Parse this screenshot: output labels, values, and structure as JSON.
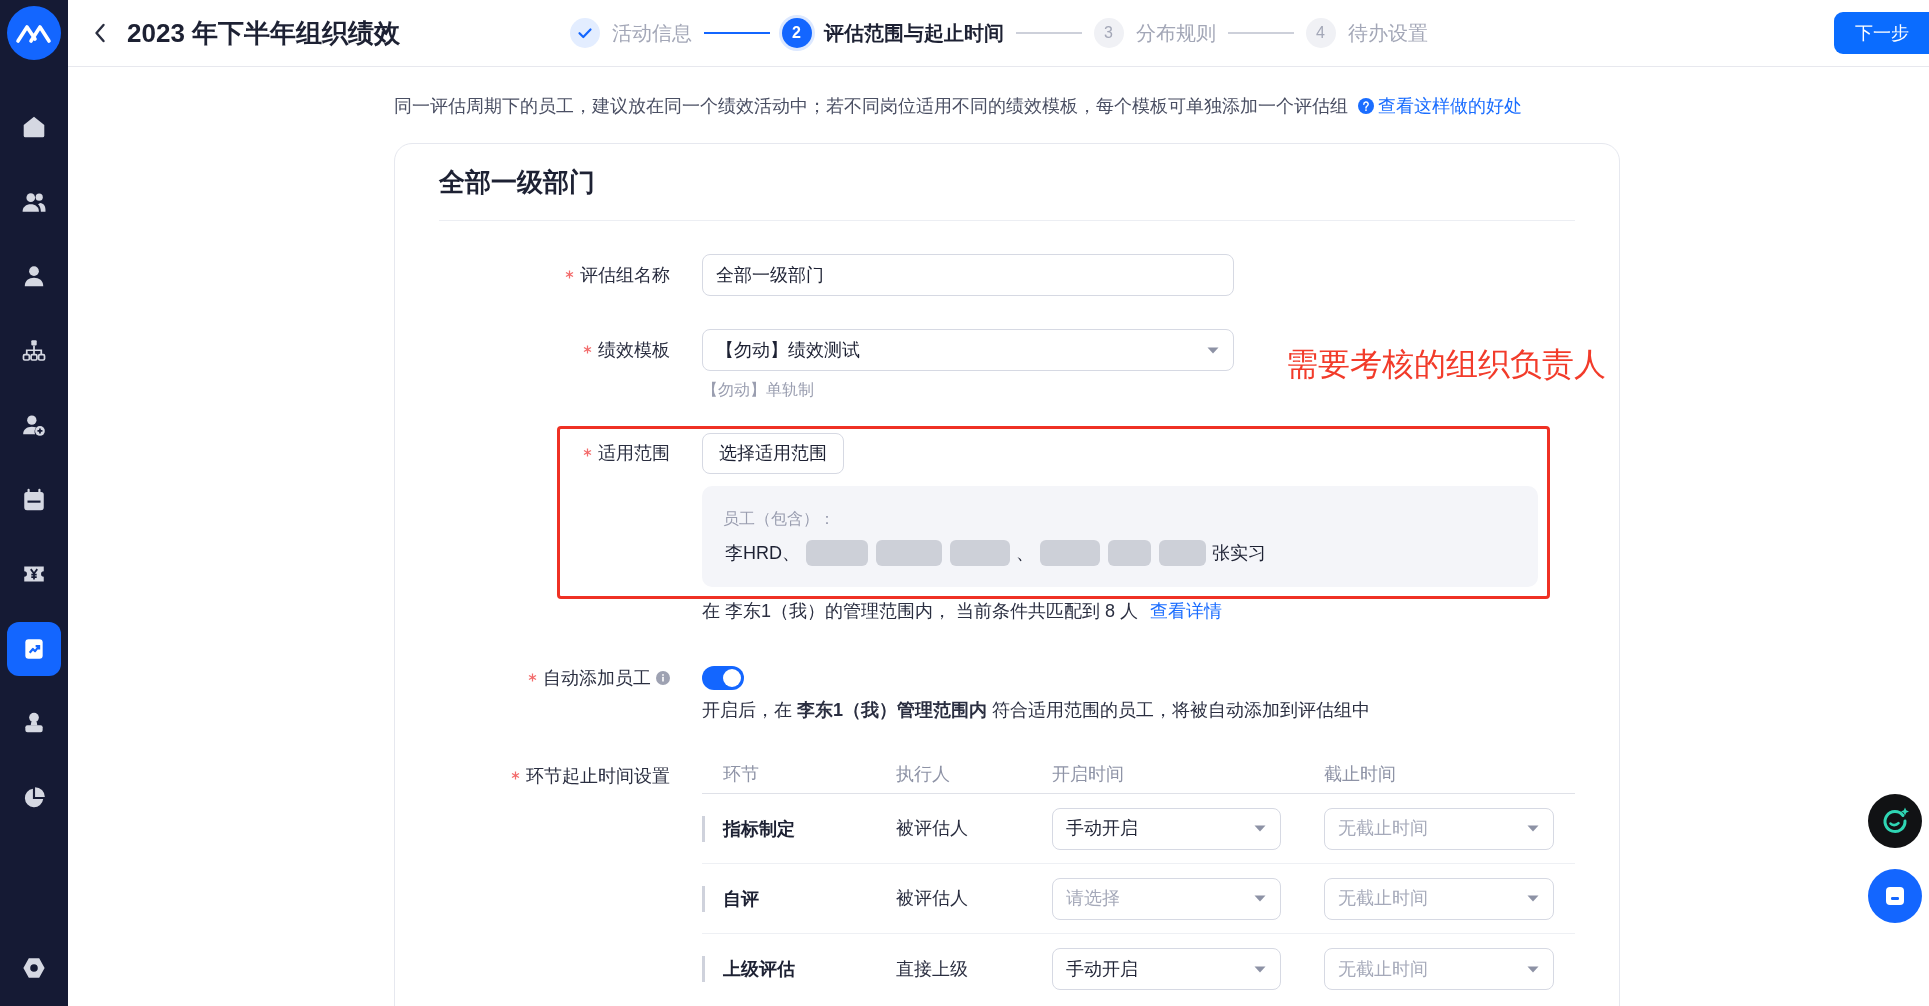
{
  "header": {
    "title": "2023 年下半年组织绩效",
    "steps": [
      {
        "label": "活动信息",
        "completed": true,
        "selected": false
      },
      {
        "number": "2",
        "label": "评估范围与起止时间",
        "completed": false,
        "selected": true
      },
      {
        "number": "3",
        "label": "分布规则",
        "completed": false,
        "selected": false
      },
      {
        "number": "4",
        "label": "待办设置",
        "completed": false,
        "selected": false
      }
    ],
    "next_button": "下一步"
  },
  "sidebar": {
    "items": [
      {
        "selected": false
      },
      {
        "selected": false
      },
      {
        "selected": false
      },
      {
        "selected": false
      },
      {
        "selected": false
      },
      {
        "selected": false
      },
      {
        "selected": false
      },
      {
        "selected": true
      },
      {
        "selected": false
      },
      {
        "selected": false
      }
    ]
  },
  "intro": {
    "text": "同一评估周期下的员工，建议放在同一个绩效活动中；若不同岗位适用不同的绩效模板，每个模板可单独添加一个评估组",
    "link": "查看这样做的好处"
  },
  "card": {
    "title": "全部一级部门",
    "group_name": {
      "label": "评估组名称",
      "required": true,
      "value": "全部一级部门"
    },
    "template": {
      "label": "绩效模板",
      "required": true,
      "value": "【勿动】绩效测试",
      "hint": "【勿动】单轨制"
    },
    "scope": {
      "label": "适用范围",
      "required": true,
      "button": "选择适用范围",
      "employees_label": "员工（包含）：",
      "employees": [
        {
          "kind": "name",
          "text": "李HRD、"
        },
        {
          "kind": "redacted"
        },
        {
          "kind": "redacted"
        },
        {
          "kind": "redacted"
        },
        {
          "kind": "name",
          "text": "、"
        },
        {
          "kind": "redacted"
        },
        {
          "kind": "redacted"
        },
        {
          "kind": "redacted"
        },
        {
          "kind": "name",
          "text": "张实习"
        }
      ],
      "match_text": "在 李东1（我）的管理范围内， 当前条件共匹配到 8 人",
      "match_link": "查看详情"
    },
    "auto_add": {
      "label": "自动添加员工",
      "required": true,
      "on": true,
      "description": "开启后，在 **李东1（我）管理范围内** 符合适用范围的员工，将被自动添加到评估组中"
    },
    "schedule": {
      "label": "环节起止时间设置",
      "required": true,
      "columns": [
        "环节",
        "执行人",
        "开启时间",
        "截止时间"
      ],
      "rows": [
        {
          "stage": "指标制定",
          "executor": "被评估人",
          "start": {
            "value": "手动开启"
          },
          "end": {
            "placeholder": "无截止时间"
          }
        },
        {
          "stage": "自评",
          "executor": "被评估人",
          "start": {
            "placeholder": "请选择"
          },
          "end": {
            "placeholder": "无截止时间"
          }
        },
        {
          "stage": "上级评估",
          "executor": "直接上级",
          "start": {
            "value": "手动开启"
          },
          "end": {
            "placeholder": "无截止时间"
          }
        }
      ]
    }
  },
  "annotation": {
    "text": "需要考核的组织负责人"
  }
}
